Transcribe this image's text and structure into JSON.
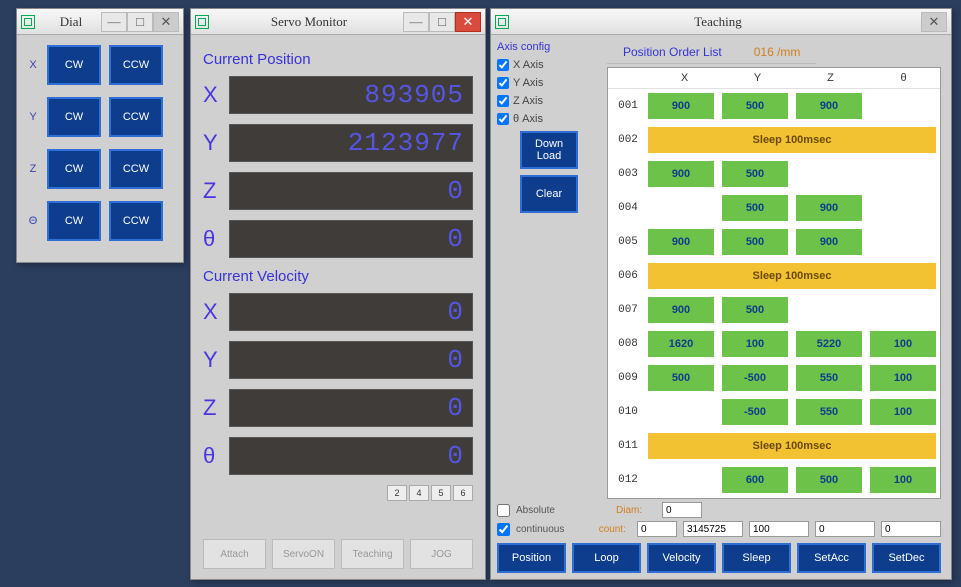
{
  "dial": {
    "title": "Dial",
    "axes": [
      "X",
      "Y",
      "Z",
      "Θ"
    ],
    "cw": "CW",
    "ccw": "CCW"
  },
  "servo": {
    "title": "Servo Monitor",
    "pos_label": "Current Position",
    "vel_label": "Current Velocity",
    "axes": [
      "X",
      "Y",
      "Z",
      "θ"
    ],
    "pos": [
      "893905",
      "2123977",
      "0",
      "0"
    ],
    "vel": [
      "0",
      "0",
      "0",
      "0"
    ],
    "small_btns": [
      "2",
      "4",
      "5",
      "6"
    ],
    "bottom": [
      "Attach",
      "ServoON",
      "Teaching",
      "JOG"
    ]
  },
  "teach": {
    "title": "Teaching",
    "axis_config_label": "Axis config",
    "checks": [
      "X Axis",
      "Y Axis",
      "Z Axis",
      "θ Axis"
    ],
    "download": "Down Load",
    "clear": "Clear",
    "tab1": "Position Order List",
    "tab2_a": "016",
    "tab2_b": "/mm",
    "headers": [
      "",
      "X",
      "Y",
      "Z",
      "θ"
    ],
    "rows": [
      {
        "idx": "001",
        "type": "pos",
        "v": [
          "900",
          "500",
          "900",
          ""
        ]
      },
      {
        "idx": "002",
        "type": "sleep",
        "text": "Sleep 100msec"
      },
      {
        "idx": "003",
        "type": "pos",
        "v": [
          "900",
          "500",
          "",
          ""
        ]
      },
      {
        "idx": "004",
        "type": "pos",
        "v": [
          "",
          "500",
          "900",
          ""
        ]
      },
      {
        "idx": "005",
        "type": "pos",
        "v": [
          "900",
          "500",
          "900",
          ""
        ]
      },
      {
        "idx": "006",
        "type": "sleep",
        "text": "Sleep 100msec"
      },
      {
        "idx": "007",
        "type": "pos",
        "v": [
          "900",
          "500",
          "",
          ""
        ]
      },
      {
        "idx": "008",
        "type": "pos",
        "v": [
          "1620",
          "100",
          "5220",
          "100"
        ]
      },
      {
        "idx": "009",
        "type": "pos",
        "v": [
          "500",
          "-500",
          "550",
          "100"
        ]
      },
      {
        "idx": "010",
        "type": "pos",
        "v": [
          "",
          "-500",
          "550",
          "100"
        ]
      },
      {
        "idx": "011",
        "type": "sleep",
        "text": "Sleep 100msec"
      },
      {
        "idx": "012",
        "type": "pos",
        "v": [
          "",
          "600",
          "500",
          "100"
        ]
      }
    ],
    "absolute_label": "Absolute",
    "continuous_label": "continuous",
    "diam_label": "Diam:",
    "count_label": "count:",
    "diam_val": "0",
    "count_val": "0",
    "f1": "3145725",
    "f2": "100",
    "f3": "0",
    "f4": "0",
    "btns": [
      "Position",
      "Loop",
      "Velocity",
      "Sleep",
      "SetAcc",
      "SetDec"
    ]
  }
}
